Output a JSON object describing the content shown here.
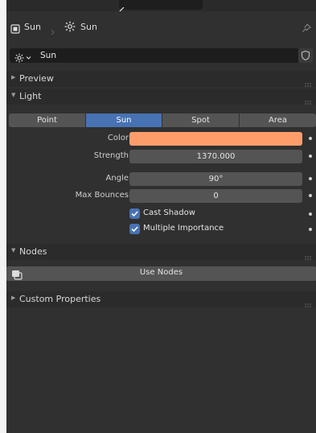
{
  "breadcrumb": {
    "object_name": "Sun",
    "light_name": "Sun"
  },
  "datablock": {
    "name": "Sun"
  },
  "sections": {
    "preview": "Preview",
    "light": "Light",
    "nodes": "Nodes",
    "custom_properties": "Custom Properties"
  },
  "light_types": [
    "Point",
    "Sun",
    "Spot",
    "Area"
  ],
  "active_light_type": "Sun",
  "properties": {
    "color_label": "Color",
    "color_value": "#ff9d6a",
    "strength_label": "Strength",
    "strength_value": "1370.000",
    "angle_label": "Angle",
    "angle_value": "90°",
    "max_bounces_label": "Max Bounces",
    "max_bounces_value": "0",
    "cast_shadow_label": "Cast Shadow",
    "cast_shadow_checked": true,
    "multiple_importance_label": "Multiple Importance",
    "multiple_importance_checked": true
  },
  "nodes": {
    "use_nodes_label": "Use Nodes"
  },
  "icons": {
    "object": "object-icon",
    "light": "sun-light-icon",
    "pin": "pin-icon",
    "shield": "fake-user-shield-icon",
    "nodes": "node-tree-icon"
  },
  "colors": {
    "accent": "#4772b3",
    "panel": "#303030",
    "field": "#545454"
  }
}
